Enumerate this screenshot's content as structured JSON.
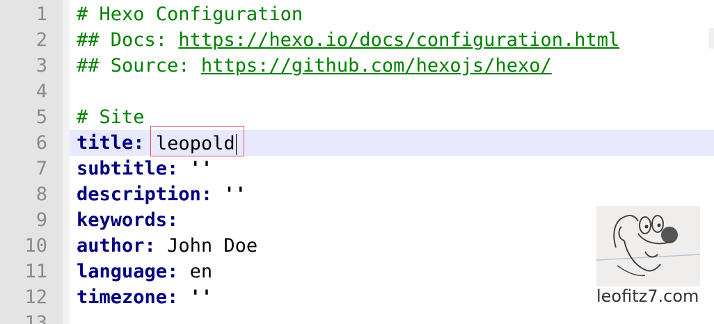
{
  "editor": {
    "lines": [
      {
        "num": "1",
        "text": "# Hexo Configuration"
      },
      {
        "num": "2",
        "prefix": "## Docs: ",
        "link": "https://hexo.io/docs/configuration.html"
      },
      {
        "num": "3",
        "prefix": "## Source: ",
        "link": "https://github.com/hexojs/hexo/"
      },
      {
        "num": "4",
        "text": ""
      },
      {
        "num": "5",
        "text": "# Site"
      },
      {
        "num": "6",
        "key": "title",
        "value": "leopold"
      },
      {
        "num": "7",
        "key": "subtitle",
        "value": "''"
      },
      {
        "num": "8",
        "key": "description",
        "value": "''"
      },
      {
        "num": "9",
        "key": "keywords",
        "value": ""
      },
      {
        "num": "10",
        "key": "author",
        "value": "John Doe"
      },
      {
        "num": "11",
        "key": "language",
        "value": "en"
      },
      {
        "num": "12",
        "key": "timezone",
        "value": "''"
      },
      {
        "num": "13",
        "text": ""
      }
    ],
    "colon": ":"
  },
  "watermark": {
    "text": "leofitz7.com",
    "icon": "dog-sketch-icon"
  },
  "colors": {
    "comment": "#008000",
    "key": "#000080",
    "current_line": "#e8e8ff",
    "selection_border": "#e05050",
    "gutter": "#e4e4e4"
  }
}
